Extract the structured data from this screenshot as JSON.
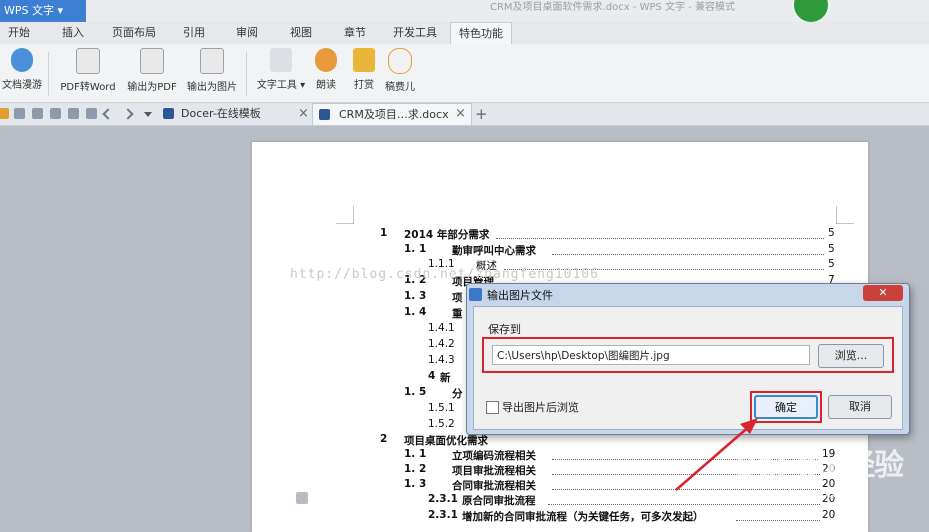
{
  "titlebar": {
    "app_label": "WPS 文字",
    "document_title": "CRM及项目桌面软件需求.docx - WPS 文字 - 兼容模式"
  },
  "menu_tabs": [
    "开始",
    "插入",
    "页面布局",
    "引用",
    "审阅",
    "视图",
    "章节",
    "开发工具",
    "特色功能"
  ],
  "ribbon": {
    "buttons": [
      "文档漫游",
      "PDF转Word",
      "输出为PDF",
      "输出为图片",
      "文字工具",
      "朗读",
      "打赏",
      "稿费儿"
    ]
  },
  "doc_tabs": {
    "tab1": "Docer-在线模板",
    "tab2": "CRM及项目…求.docx",
    "close": "×",
    "add": "+"
  },
  "toc": [
    {
      "num": "1",
      "title": "2014 年部分需求",
      "page": "5"
    },
    {
      "num": "1. 1",
      "title": "勤审呼叫中心需求",
      "page": "5"
    },
    {
      "num": "1.1.1",
      "title": "概述",
      "page": "5"
    },
    {
      "num": "1. 2",
      "title": "项目管理",
      "page": "7"
    },
    {
      "num": "1. 3",
      "title": "项",
      "page": ""
    },
    {
      "num": "1. 4",
      "title": "重",
      "page": ""
    },
    {
      "num": "1.4.1",
      "title": "",
      "page": ""
    },
    {
      "num": "1.4.2",
      "title": "",
      "page": ""
    },
    {
      "num": "1.4.3",
      "title": "",
      "page": ""
    },
    {
      "num": "4",
      "title": "新",
      "page": ""
    },
    {
      "num": "1. 5",
      "title": "分",
      "page": ""
    },
    {
      "num": "1.5.1",
      "title": "",
      "page": ""
    },
    {
      "num": "1.5.2",
      "title": "",
      "page": ""
    },
    {
      "num": "2",
      "title": "项目桌面优化需求",
      "page": ""
    },
    {
      "num": "1. 1",
      "title": "立项编码流程相关",
      "page": "19"
    },
    {
      "num": "1. 2",
      "title": "项目审批流程相关",
      "page": "20"
    },
    {
      "num": "1. 3",
      "title": "合同审批流程相关",
      "page": "20"
    },
    {
      "num": "2.3.1",
      "title": "原合同审批流程",
      "page": "20"
    },
    {
      "num": "2.3.1",
      "title": "增加新的合同审批流程（为关键任务，可多次发起）",
      "page": "20"
    }
  ],
  "watermark": "http://blog.csdn.net/zhangfeng10106",
  "dialog": {
    "title": "输出图片文件",
    "close": "✕",
    "save_to_label": "保存到",
    "path_value": "C:\\Users\\hp\\Desktop\\图编图片.jpg",
    "browse_label": "浏览...",
    "checkbox_label": "导出图片后浏览",
    "ok_label": "确定",
    "cancel_label": "取消"
  },
  "baidu_watermark": {
    "logo": "Bai du 经验",
    "sub": "jingyan.baidu.com"
  },
  "colors": {
    "app_blue": "#3d7fd3",
    "highlight_red": "#d8242d",
    "dialog_frame": "#c7d6ea",
    "close_red": "#c8413a"
  }
}
